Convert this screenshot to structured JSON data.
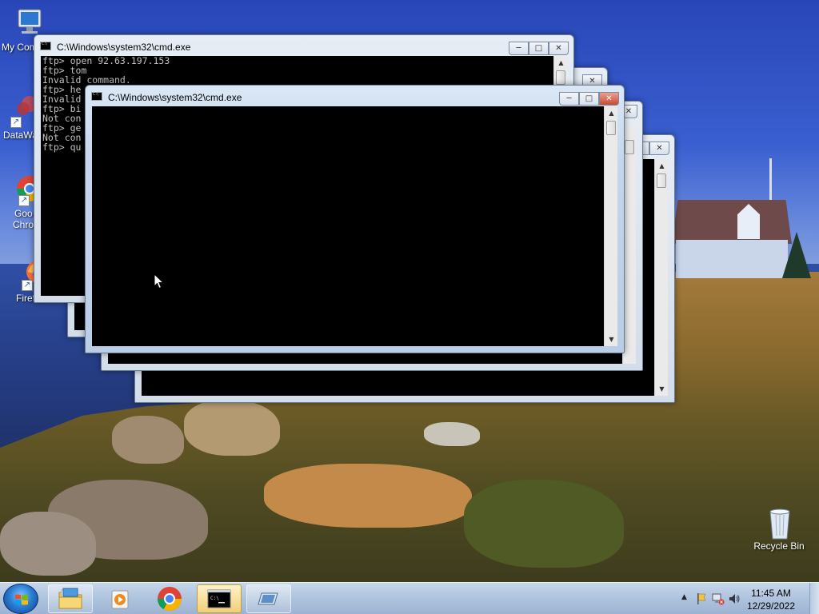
{
  "desktop": {
    "icons": [
      {
        "id": "my-computer",
        "label": "My Computer",
        "visible_label": "My Com"
      },
      {
        "id": "datawarehouse",
        "label": "DataWa",
        "visible_label": "DataWa"
      },
      {
        "id": "google-chrome",
        "label": "Google Chrome",
        "visible_label_line1": "Goo",
        "visible_label_line2": "Chro"
      },
      {
        "id": "firefox",
        "label": "Firefox",
        "visible_label": "Firefox"
      },
      {
        "id": "recycle-bin",
        "label": "Recycle Bin",
        "visible_label": "Recycle Bin"
      }
    ]
  },
  "windows": [
    {
      "id": "cmd-back-left",
      "title": "C:\\Windows\\system32\\cmd.exe",
      "console_lines": [
        "ftp> open 92.63.197.153",
        "ftp> tom",
        "Invalid command.",
        "ftp> he",
        "Invalid",
        "ftp> bi",
        "Not con",
        "ftp> ge",
        "Not con",
        "ftp> qu"
      ]
    },
    {
      "id": "cmd-front",
      "title": "C:\\Windows\\system32\\cmd.exe",
      "console_lines": []
    }
  ],
  "taskbar": {
    "items": [
      {
        "id": "windows-explorer",
        "icon": "folder-icon"
      },
      {
        "id": "media-player",
        "icon": "media-player-icon"
      },
      {
        "id": "chrome",
        "icon": "chrome-icon"
      },
      {
        "id": "cmd",
        "icon": "cmd-icon",
        "active": true
      },
      {
        "id": "remote-desktop",
        "icon": "remote-desktop-icon"
      }
    ],
    "clock": {
      "time": "11:45 AM",
      "date": "12/29/2022"
    }
  },
  "colors": {
    "accent": "#2b7fd6",
    "console_bg": "#000000",
    "console_fg": "#c0c0c0",
    "taskbar": "#aec3dd"
  }
}
